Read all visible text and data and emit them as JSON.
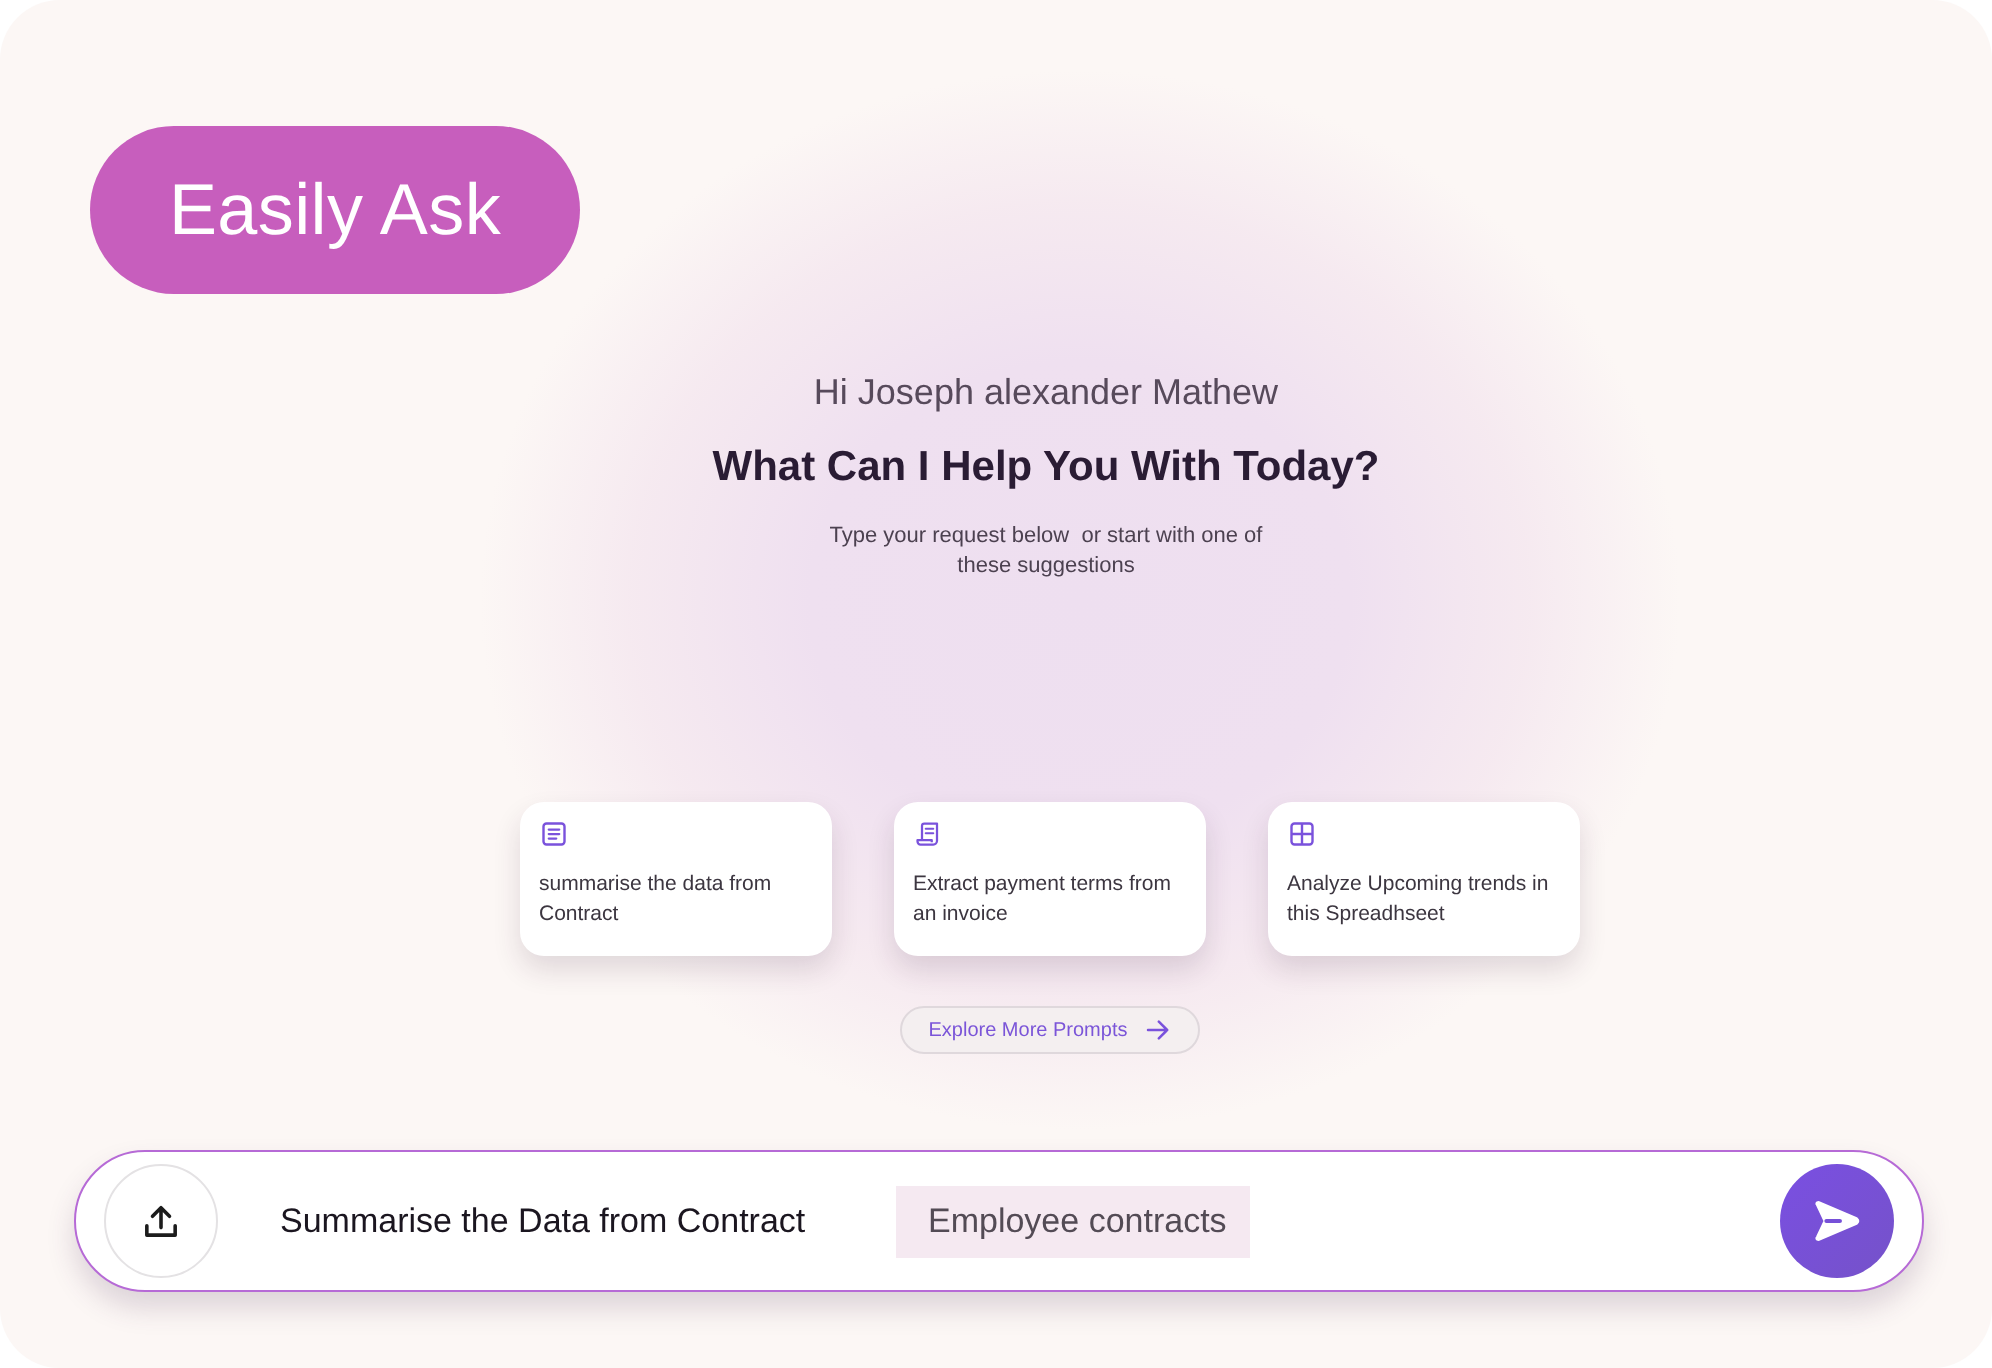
{
  "badge": {
    "label": "Easily Ask"
  },
  "greeting": "Hi Joseph alexander Mathew",
  "heading": "What Can I Help You With Today?",
  "subtitle": "Type your request below  or start with one of these suggestions",
  "suggestions": [
    {
      "kind": "document",
      "text": "summarise the data from Contract"
    },
    {
      "kind": "receipt",
      "text": "Extract payment terms from an invoice"
    },
    {
      "kind": "grid",
      "text": "Analyze Upcoming trends in this Spreadhseet"
    }
  ],
  "explore_button": {
    "label": "Explore More Prompts"
  },
  "prompt_bar": {
    "value": "Summarise the Data from Contract",
    "tag": "Employee contracts"
  }
}
